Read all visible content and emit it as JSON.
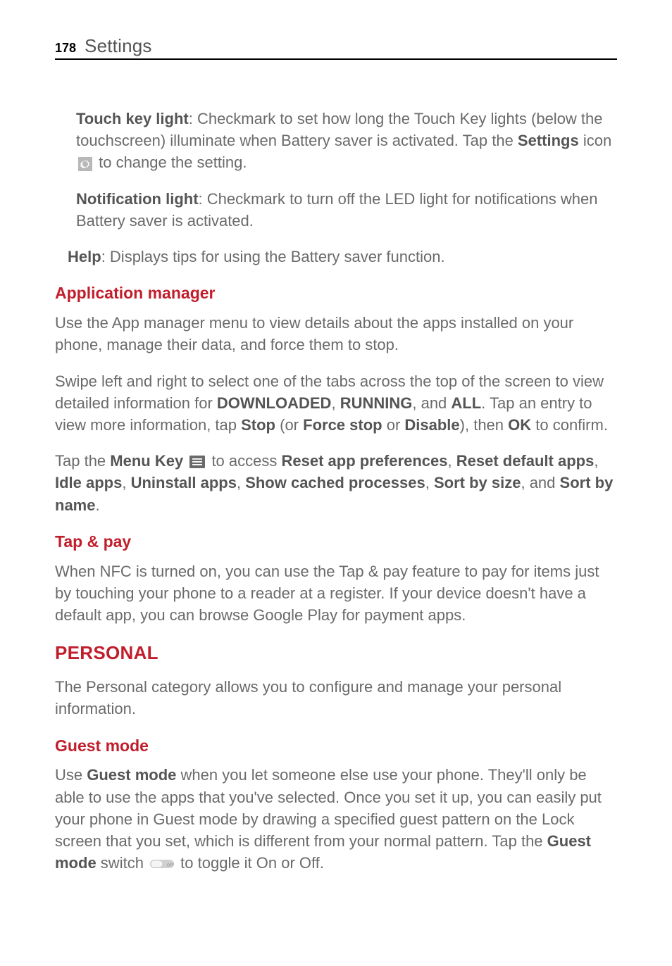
{
  "header": {
    "page_number": "178",
    "title": "Settings"
  },
  "touch_key": {
    "label": "Touch key light",
    "text_after_label": ": Checkmark to set how long the Touch Key lights (below the touchscreen) illuminate when Battery saver is activated. Tap the ",
    "settings_label": "Settings",
    "text_after_settings": " icon ",
    "text_after_icon": " to change the setting."
  },
  "notification_light": {
    "label": "Notification light",
    "text": ": Checkmark to turn off the LED light for notifications when Battery saver is activated."
  },
  "help": {
    "label": "Help",
    "text": ": Displays tips for using the Battery saver function."
  },
  "app_manager": {
    "heading": "Application manager",
    "para1": "Use the App manager menu to view details about the apps installed on your phone, manage their data, and force them to stop.",
    "p2_a": "Swipe left and right to select one of the tabs across the top of the screen to view detailed information for ",
    "p2_downloaded": "DOWNLOADED",
    "p2_b": ", ",
    "p2_running": "RUNNING",
    "p2_c": ", and ",
    "p2_all": "ALL",
    "p2_d": ". Tap an entry to view more information, tap ",
    "p2_stop": "Stop",
    "p2_e": " (or ",
    "p2_force": "Force stop",
    "p2_f": " or ",
    "p2_disable": "Disable",
    "p2_g": "), then ",
    "p2_ok": "OK",
    "p2_h": " to confirm.",
    "p3_a": "Tap the ",
    "p3_menu": "Menu Key",
    "p3_b": " to access ",
    "p3_reset_pref": "Reset app preferences",
    "p3_c": ", ",
    "p3_reset_def": "Reset default apps",
    "p3_d": ", ",
    "p3_idle": "Idle apps",
    "p3_e": ", ",
    "p3_uninstall": "Uninstall apps",
    "p3_f": ", ",
    "p3_cached": "Show cached processes",
    "p3_g": ", ",
    "p3_sort_size": "Sort by size",
    "p3_h": ", and ",
    "p3_sort_name": "Sort by name",
    "p3_i": "."
  },
  "tap_pay": {
    "heading": "Tap & pay",
    "text": "When NFC is turned on, you can use the Tap & pay feature to pay for items just by touching your phone to a reader at a register. If your device doesn't have a default app, you can browse Google Play for payment apps."
  },
  "personal": {
    "heading": "PERSONAL",
    "text": "The Personal category allows you to configure and manage your personal information."
  },
  "guest": {
    "heading": "Guest mode",
    "p_a": "Use ",
    "p_gm1": "Guest mode",
    "p_b": " when you let someone else use your phone. They'll only be able to use the apps that you've selected. Once you set it up, you can easily put your phone in Guest mode by drawing a specified guest pattern on the Lock screen that you set, which is different from your normal pattern. Tap the ",
    "p_gm2": "Guest mode",
    "p_c": " switch ",
    "p_d": " to toggle it On or Off."
  }
}
